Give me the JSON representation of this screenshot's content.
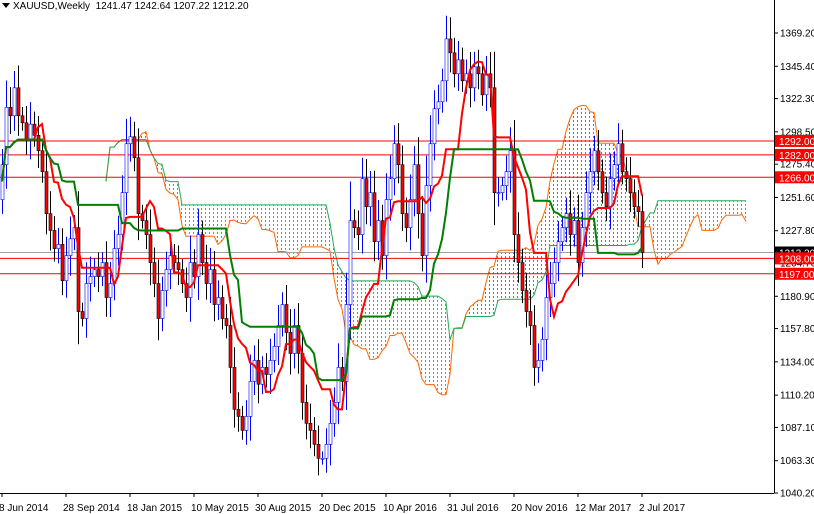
{
  "header": {
    "symbol": "XAUUSD,Weekly",
    "ohlc": "1241.47 1242.64 1207.22 1212.20"
  },
  "chart_data": {
    "type": "candlestick",
    "title": "XAUUSD,Weekly",
    "indicator": "Ichimoku Kinko Hyo (9, 26, 52)",
    "ylim": [
      1040.2,
      1369.2
    ],
    "y_ticks": [
      "1369.20",
      "1345.40",
      "1322.30",
      "1298.50",
      "1275.40",
      "1251.60",
      "1227.80",
      "1204.70",
      "1180.90",
      "1157.80",
      "1134.00",
      "1110.20",
      "1087.10",
      "1063.30",
      "1040.20"
    ],
    "x_labels": [
      {
        "week_index": 0,
        "label": "8 Jun 2014"
      },
      {
        "week_index": 16,
        "label": "28 Sep 2014"
      },
      {
        "week_index": 32,
        "label": "18 Jan 2015"
      },
      {
        "week_index": 48,
        "label": "10 May 2015"
      },
      {
        "week_index": 64,
        "label": "30 Aug 2015"
      },
      {
        "week_index": 80,
        "label": "20 Dec 2015"
      },
      {
        "week_index": 96,
        "label": "10 Apr 2016"
      },
      {
        "week_index": 112,
        "label": "31 Jul 2016"
      },
      {
        "week_index": 128,
        "label": "20 Nov 2016"
      },
      {
        "week_index": 144,
        "label": "12 Mar 2017"
      },
      {
        "week_index": 160,
        "label": "2 Jul 2017"
      }
    ],
    "first_open": 1250,
    "closes": [
      1275,
      1316,
      1310,
      1330,
      1310,
      1305,
      1293,
      1304,
      1296,
      1285,
      1270,
      1240,
      1228,
      1215,
      1218,
      1192,
      1210,
      1222,
      1230,
      1170,
      1165,
      1190,
      1195,
      1200,
      1195,
      1205,
      1180,
      1190,
      1215,
      1225,
      1255,
      1290,
      1295,
      1280,
      1240,
      1235,
      1225,
      1205,
      1190,
      1165,
      1185,
      1200,
      1210,
      1205,
      1200,
      1190,
      1180,
      1205,
      1195,
      1225,
      1205,
      1190,
      1200,
      1175,
      1180,
      1165,
      1160,
      1130,
      1100,
      1095,
      1085,
      1095,
      1120,
      1135,
      1118,
      1130,
      1125,
      1135,
      1145,
      1160,
      1175,
      1155,
      1140,
      1160,
      1140,
      1105,
      1090,
      1085,
      1075,
      1065,
      1065,
      1075,
      1090,
      1105,
      1130,
      1120,
      1175,
      1235,
      1230,
      1225,
      1265,
      1245,
      1255,
      1220,
      1235,
      1210,
      1250,
      1265,
      1290,
      1275,
      1240,
      1230,
      1250,
      1275,
      1240,
      1210,
      1260,
      1290,
      1315,
      1320,
      1335,
      1365,
      1355,
      1340,
      1350,
      1335,
      1340,
      1330,
      1345,
      1340,
      1325,
      1340,
      1330,
      1255,
      1255,
      1260,
      1270,
      1285,
      1225,
      1205,
      1185,
      1170,
      1160,
      1130,
      1135,
      1150,
      1180,
      1190,
      1205,
      1220,
      1230,
      1240,
      1225,
      1235,
      1205,
      1230,
      1255,
      1270,
      1285,
      1270,
      1255,
      1245,
      1265,
      1275,
      1290,
      1270,
      1265,
      1255,
      1245,
      1241.47,
      1212.2
    ],
    "levels": [
      {
        "price": 1292.0,
        "label": "1292.00"
      },
      {
        "price": 1282.0,
        "label": "1282.00"
      },
      {
        "price": 1266.0,
        "label": "1266.00"
      },
      {
        "price": 1208.0,
        "label": "1208.00"
      },
      {
        "price": 1197.0,
        "label": "1197.00"
      }
    ],
    "current_price": {
      "price": 1212.2,
      "label": "1212.20"
    },
    "colors": {
      "bull": "#0000ff",
      "bear_body": "#ff0000",
      "bear_wick": "#000000",
      "tenkan": "#ff0000",
      "kijun": "#008000",
      "cloud_bull": "#22aa55",
      "cloud_bear": "#ff6600",
      "level": "#ff0000"
    }
  }
}
